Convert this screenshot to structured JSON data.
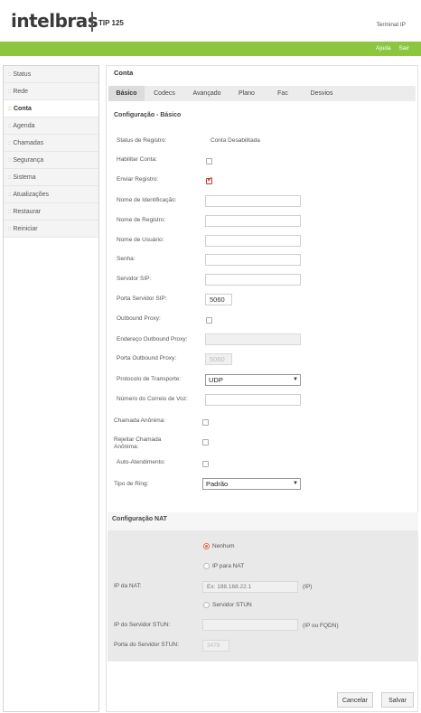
{
  "header": {
    "logo": "intelbras",
    "model": "TIP 125",
    "device": "Terminal IP"
  },
  "topnav": {
    "help": "Ajuda",
    "logout": "Sair"
  },
  "sidebar": {
    "items": [
      {
        "label": "Status"
      },
      {
        "label": "Rede"
      },
      {
        "label": "Conta"
      },
      {
        "label": "Agenda"
      },
      {
        "label": "Chamadas"
      },
      {
        "label": "Segurança"
      },
      {
        "label": "Sistema"
      },
      {
        "label": "Atualizações"
      },
      {
        "label": "Restaurar"
      },
      {
        "label": "Reiniciar"
      }
    ],
    "active_index": 2
  },
  "page": {
    "title": "Conta"
  },
  "tabs": [
    "Básico",
    "Codecs",
    "Avançado",
    "Plano",
    "Fac",
    "Desvios"
  ],
  "active_tab": "Básico",
  "basic": {
    "section_title": "Configuração - Básico",
    "status_label": "Status de Registro:",
    "status_value": "Conta Desabilitada",
    "enable_label": "Habilitar Conta:",
    "enable_checked": false,
    "send_reg_label": "Enviar Registro:",
    "send_reg_checked": true,
    "id_name_label": "Nome de Identificação:",
    "id_name_value": "",
    "reg_name_label": "Nome de Registro:",
    "reg_name_value": "",
    "user_name_label": "Nome de Usuário:",
    "user_name_value": "",
    "password_label": "Senha:",
    "password_value": "",
    "sip_server_label": "Servidor SIP:",
    "sip_server_value": "",
    "sip_port_label": "Porta Servidor SIP:",
    "sip_port_value": "5060",
    "outbound_label": "Outbound Proxy:",
    "outbound_checked": false,
    "outbound_addr_label": "Endereço Outbound Proxy:",
    "outbound_addr_value": "",
    "outbound_port_label": "Porta Outbound Proxy:",
    "outbound_port_value": "5060",
    "transport_label": "Protocolo de Transporte:",
    "transport_value": "UDP",
    "voicemail_label": "Número do Correio de Voz:",
    "voicemail_value": "",
    "anon_call_label": "Chamada Anônima:",
    "anon_call_checked": false,
    "reject_anon_label_1": "Rejeitar Chamada",
    "reject_anon_label_2": "Anônima:",
    "reject_anon_checked": false,
    "auto_answer_label": "Auto-Atendimento:",
    "auto_answer_checked": false,
    "ring_type_label": "Tipo de Ring:",
    "ring_type_value": "Padrão"
  },
  "nat": {
    "section_title": "Configuração NAT",
    "opt_none": "Nenhum",
    "opt_ip": "IP para NAT",
    "opt_stun": "Servidor STUN",
    "selected": "Nenhum",
    "nat_ip_label": "IP da NAT:",
    "nat_ip_placeholder": "Ex: 198.168.22.1",
    "nat_ip_suffix": "(IP)",
    "stun_server_label": "IP do Servidor STUN:",
    "stun_server_value": "",
    "stun_server_suffix": "(IP ou FQDN)",
    "stun_port_label": "Porta do Servidor STUN:",
    "stun_port_value": "3478"
  },
  "actions": {
    "cancel": "Cancelar",
    "save": "Salvar"
  },
  "colors": {
    "brand_green": "#8cc63f",
    "accent_red": "#e8674a"
  }
}
